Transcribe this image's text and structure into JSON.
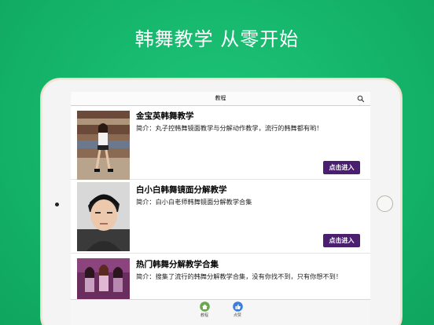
{
  "headline": "韩舞教学 从零开始",
  "app": {
    "nav_title": "教程",
    "items": [
      {
        "title": "金宝英韩舞教学",
        "description": "简介：丸子控韩舞镜面教学与分解动作教学，流行的韩舞都有哟！",
        "button_label": "点击进入"
      },
      {
        "title": "白小白韩舞镜面分解教学",
        "description": "简介：白小白老师韩舞镜面分解教学合集",
        "button_label": "点击进入"
      },
      {
        "title": "热门韩舞分解教学合集",
        "description": "简介：搜集了流行的韩舞分解教学合集，没有你找不到，只有你想不到！",
        "button_label": ""
      }
    ],
    "tabs": [
      {
        "label": "教程",
        "icon": "home-icon"
      },
      {
        "label": "点赞",
        "icon": "thumbs-up-icon"
      }
    ]
  },
  "colors": {
    "background": "#16b86d",
    "button": "#4a1f6f",
    "tab_home": "#6aa84f",
    "tab_like": "#3b7ddd"
  }
}
